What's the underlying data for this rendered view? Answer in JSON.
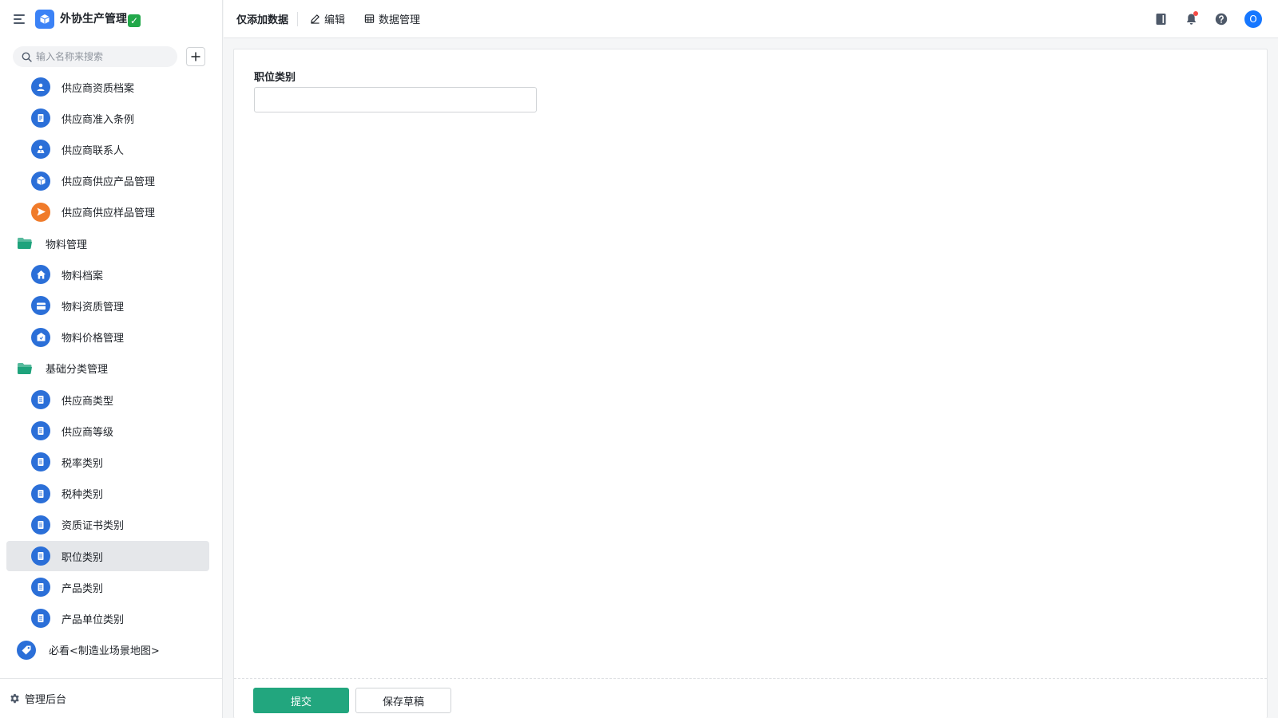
{
  "app": {
    "title": "外协生产管理",
    "title_badge": "✓",
    "logo_icon": "cube-icon",
    "accent_color": "#3b82f6"
  },
  "sidebar": {
    "search_placeholder": "输入名称来搜索",
    "items": [
      {
        "label": "供应商资质档案",
        "kind": "child",
        "icon": "person-badge-icon",
        "color": "#2b6fd8"
      },
      {
        "label": "供应商准入条例",
        "kind": "child",
        "icon": "document-icon",
        "color": "#2b6fd8"
      },
      {
        "label": "供应商联系人",
        "kind": "child",
        "icon": "contact-icon",
        "color": "#2b6fd8"
      },
      {
        "label": "供应商供应产品管理",
        "kind": "child",
        "icon": "box-icon",
        "color": "#2b6fd8"
      },
      {
        "label": "供应商供应样品管理",
        "kind": "child",
        "icon": "send-icon",
        "color": "#f07b2a"
      },
      {
        "label": "物料管理",
        "kind": "folder",
        "icon": "folder-icon",
        "color": "#1fa37c"
      },
      {
        "label": "物料档案",
        "kind": "child",
        "icon": "home-icon",
        "color": "#2b6fd8"
      },
      {
        "label": "物料资质管理",
        "kind": "child",
        "icon": "wallet-icon",
        "color": "#2b6fd8"
      },
      {
        "label": "物料价格管理",
        "kind": "child",
        "icon": "price-tag-icon",
        "color": "#2b6fd8"
      },
      {
        "label": "基础分类管理",
        "kind": "folder",
        "icon": "folder-icon",
        "color": "#1fa37c"
      },
      {
        "label": "供应商类型",
        "kind": "child",
        "icon": "form-icon",
        "color": "#2b6fd8"
      },
      {
        "label": "供应商等级",
        "kind": "child",
        "icon": "form-icon",
        "color": "#2b6fd8"
      },
      {
        "label": "税率类别",
        "kind": "child",
        "icon": "form-icon",
        "color": "#2b6fd8"
      },
      {
        "label": "税种类别",
        "kind": "child",
        "icon": "form-icon",
        "color": "#2b6fd8"
      },
      {
        "label": "资质证书类别",
        "kind": "child",
        "icon": "form-icon",
        "color": "#2b6fd8"
      },
      {
        "label": "职位类别",
        "kind": "child",
        "icon": "form-icon",
        "color": "#2b6fd8",
        "active": true
      },
      {
        "label": "产品类别",
        "kind": "child",
        "icon": "form-icon",
        "color": "#2b6fd8"
      },
      {
        "label": "产品单位类别",
        "kind": "child",
        "icon": "form-icon",
        "color": "#2b6fd8"
      },
      {
        "label": "必看<制造业场景地图>",
        "kind": "folder",
        "icon": "location-tag-icon",
        "color": "#2b6fd8"
      }
    ],
    "footer_label": "管理后台"
  },
  "topbar": {
    "title": "仅添加数据",
    "edit_label": "编辑",
    "data_manage_label": "数据管理",
    "avatar_text": "O"
  },
  "form": {
    "field_label": "职位类别",
    "field_value": "",
    "submit_label": "提交",
    "draft_label": "保存草稿",
    "submit_color": "#22a67e"
  }
}
